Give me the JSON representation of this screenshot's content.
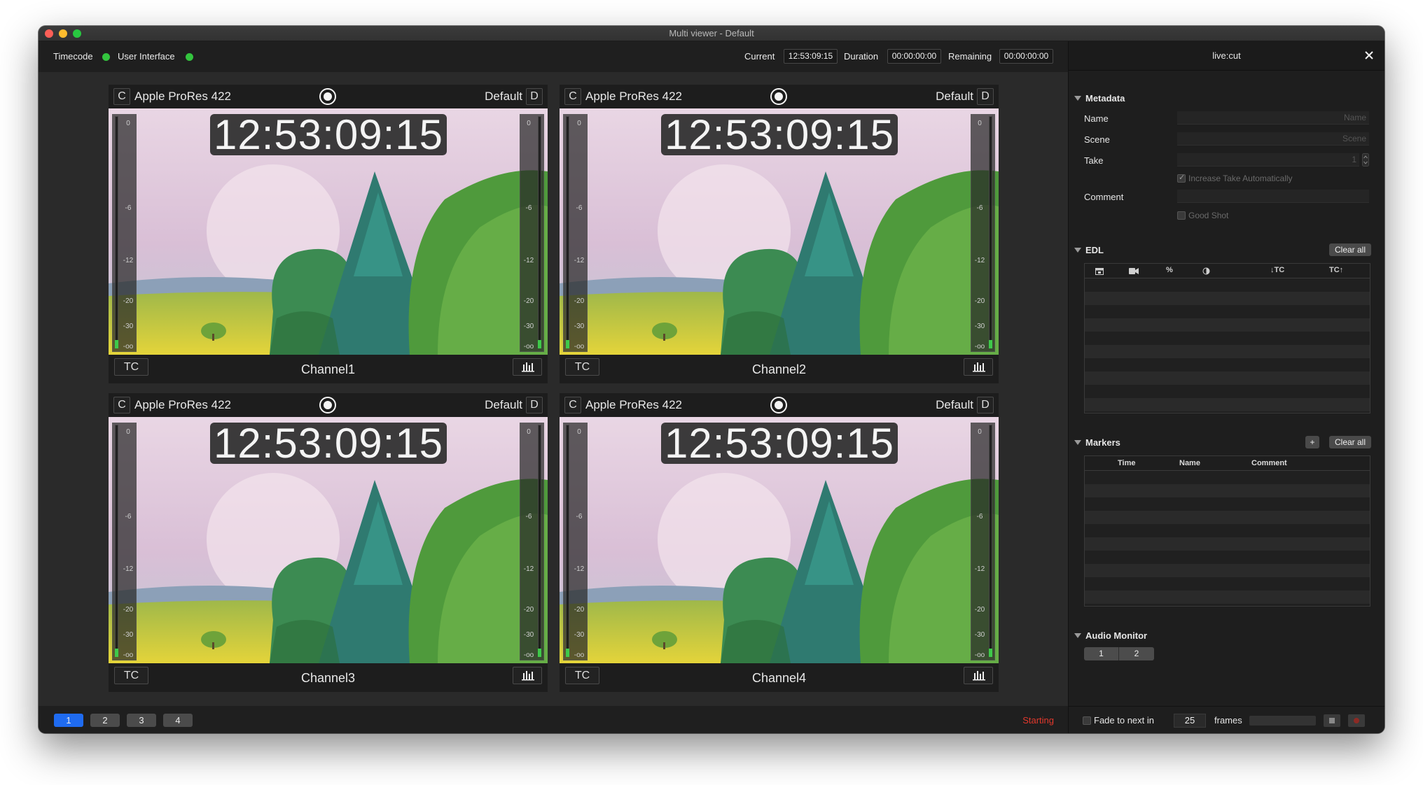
{
  "window": {
    "title": "Multi viewer - Default"
  },
  "toolbar": {
    "timecode_label": "Timecode",
    "ui_label": "User Interface",
    "current_label": "Current",
    "current_value": "12:53:09:15",
    "duration_label": "Duration",
    "duration_value": "00:00:00:00",
    "remaining_label": "Remaining",
    "remaining_value": "00:00:00:00",
    "status_color": "#33c43e"
  },
  "viewers": [
    {
      "left_btn": "C",
      "codec": "Apple ProRes 422",
      "preset": "Default",
      "right_btn": "D",
      "timecode": "12:53:09:15",
      "tc_btn": "TC",
      "channel": "Channel1"
    },
    {
      "left_btn": "C",
      "codec": "Apple ProRes 422",
      "preset": "Default",
      "right_btn": "D",
      "timecode": "12:53:09:15",
      "tc_btn": "TC",
      "channel": "Channel2"
    },
    {
      "left_btn": "C",
      "codec": "Apple ProRes 422",
      "preset": "Default",
      "right_btn": "D",
      "timecode": "12:53:09:15",
      "tc_btn": "TC",
      "channel": "Channel3"
    },
    {
      "left_btn": "C",
      "codec": "Apple ProRes 422",
      "preset": "Default",
      "right_btn": "D",
      "timecode": "12:53:09:15",
      "tc_btn": "TC",
      "channel": "Channel4"
    }
  ],
  "meter_ticks": [
    "0",
    "-6",
    "-12",
    "-20",
    "-30",
    "-oo"
  ],
  "bottombar": {
    "pages": [
      "1",
      "2",
      "3",
      "4"
    ],
    "status": "Starting",
    "status_color": "#e2382c",
    "active_color": "#1f6bf0"
  },
  "panel": {
    "title": "live:cut",
    "metadata": {
      "heading": "Metadata",
      "name_label": "Name",
      "name_placeholder": "Name",
      "scene_label": "Scene",
      "scene_placeholder": "Scene",
      "take_label": "Take",
      "take_value": "1",
      "increase_take": "Increase Take Automatically",
      "comment_label": "Comment",
      "good_shot": "Good Shot"
    },
    "edl": {
      "heading": "EDL",
      "clear_all": "Clear all",
      "col_icons": [
        "calendar-icon",
        "camera-icon",
        "percent-icon",
        "clock-icon"
      ],
      "col_percent": "%",
      "col_tc_in": "↓TC",
      "col_tc_out": "TC↑"
    },
    "markers": {
      "heading": "Markers",
      "add": "+",
      "clear_all": "Clear all",
      "columns": [
        "Time",
        "Name",
        "Comment"
      ]
    },
    "audio_monitor": {
      "heading": "Audio Monitor",
      "channels": [
        "1",
        "2"
      ]
    },
    "bottom": {
      "fade_label": "Fade to next in",
      "frames_value": "25",
      "frames_label": "frames"
    }
  }
}
